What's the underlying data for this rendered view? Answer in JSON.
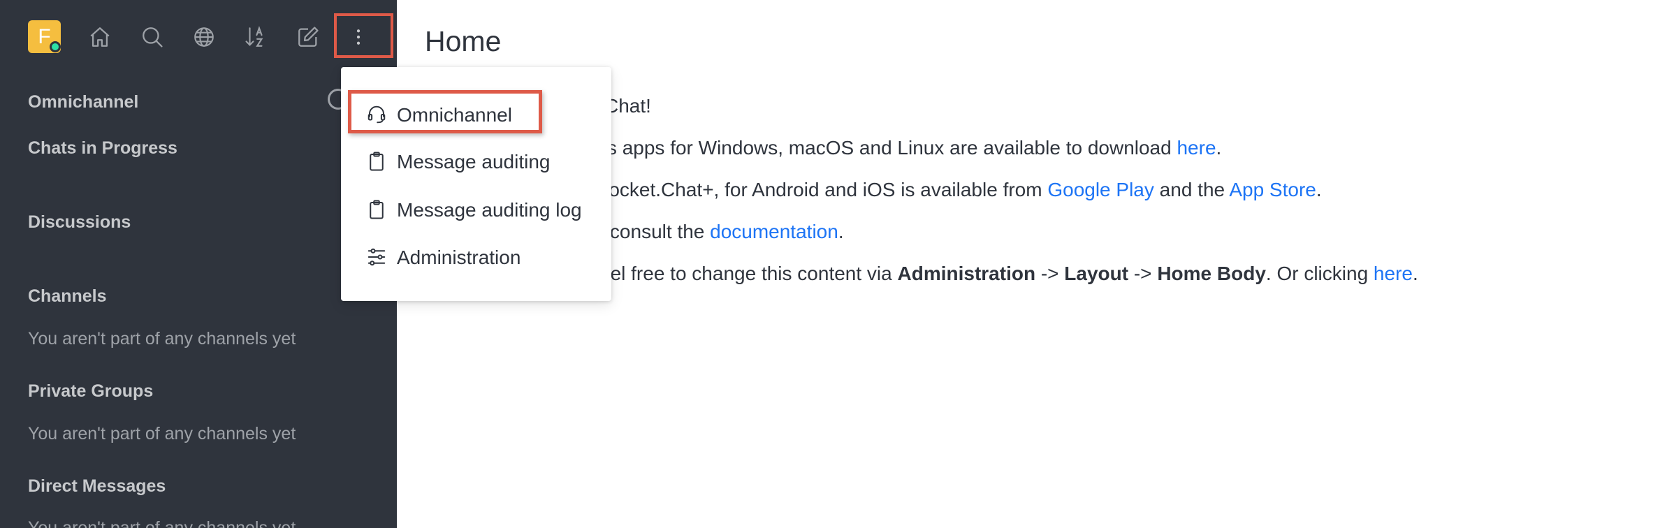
{
  "user": {
    "initial": "F",
    "status_color": "#2de0a5",
    "avatar_color": "#f5be3f"
  },
  "toolbar": {
    "icons": [
      "home-icon",
      "search-icon",
      "directory-globe-icon",
      "sort-icon",
      "create-new-icon",
      "kebab-menu-icon"
    ]
  },
  "sidebar": {
    "sections": [
      {
        "title": "Omnichannel"
      },
      {
        "title": "Chats in Progress"
      },
      {
        "title": "Discussions"
      },
      {
        "title": "Channels",
        "empty": "You aren't part of any channels yet"
      },
      {
        "title": "Private Groups",
        "empty": "You aren't part of any channels yet"
      },
      {
        "title": "Direct Messages",
        "empty": "You aren't part of any channels yet"
      }
    ]
  },
  "main": {
    "title": "Home",
    "line1": "Chat!",
    "line2_prefix": "ktops apps for Windows, macOS and Linux are available to download ",
    "line2_link": "here",
    "line2_suffix": ".",
    "line3_prefix": "p, Rocket.Chat+, for Android and iOS is available from ",
    "line3_link1": "Google Play",
    "line3_mid": " and the ",
    "line3_link2": "App Store",
    "line3_suffix": ".",
    "line4_prefix": "ase consult the ",
    "line4_link": "documentation",
    "line4_suffix": ".",
    "line5_prefix": "eel free to change this content via ",
    "line5_b1": "Administration",
    "line5_arrow1": " -> ",
    "line5_b2": "Layout",
    "line5_arrow2": " -> ",
    "line5_b3": "Home Body",
    "line5_mid": ". Or clicking ",
    "line5_link": "here",
    "line5_suffix": "."
  },
  "menu": {
    "items": [
      {
        "label": "Omnichannel",
        "icon": "headset-icon"
      },
      {
        "label": "Message auditing",
        "icon": "clipboard-icon"
      },
      {
        "label": "Message auditing log",
        "icon": "clipboard-icon"
      },
      {
        "label": "Administration",
        "icon": "sliders-icon"
      }
    ]
  },
  "colors": {
    "sidebar_bg": "#2f343d",
    "link": "#1d74f5",
    "highlight": "#de5a48"
  }
}
